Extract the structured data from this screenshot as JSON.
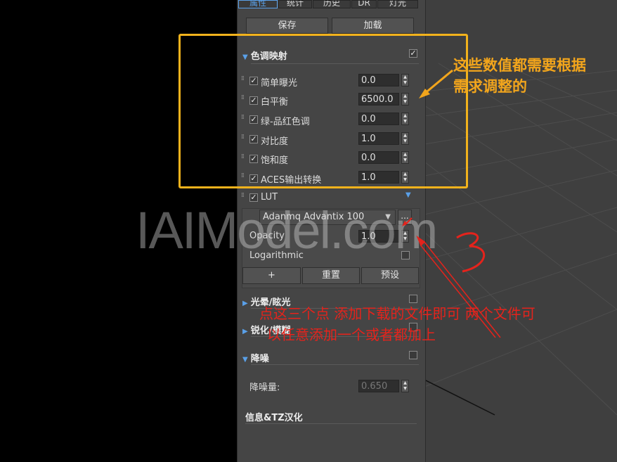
{
  "tabs": [
    {
      "label": "属性",
      "active": true
    },
    {
      "label": "统计",
      "active": false
    },
    {
      "label": "历史",
      "active": false
    },
    {
      "label": "DR",
      "active": false
    },
    {
      "label": "灯光",
      "active": false
    }
  ],
  "buttons": {
    "save": "保存",
    "load": "加载"
  },
  "tone_mapping": {
    "title": "色调映射",
    "enabled": true,
    "rows": [
      {
        "label": "简单曝光",
        "value": "0.0"
      },
      {
        "label": "白平衡",
        "value": "6500.0"
      },
      {
        "label": "绿-品红色调",
        "value": "0.0"
      },
      {
        "label": "对比度",
        "value": "1.0"
      },
      {
        "label": "饱和度",
        "value": "0.0"
      },
      {
        "label": "ACES输出转换",
        "value": "1.0"
      }
    ]
  },
  "lut": {
    "label": "LUT",
    "file": "Adanmq Advantix 100",
    "browse": "...",
    "opacity_label": "Opacity",
    "opacity_value": "1.0",
    "logarithmic_label": "Logarithmic",
    "add": "+",
    "reset": "重置",
    "preset": "预设"
  },
  "sections": {
    "bloom": "光晕/眩光",
    "sharpen": "锐化/模糊",
    "denoise": "降噪",
    "denoise_amount_label": "降噪量:",
    "denoise_amount": "0.650",
    "info": "信息&TZ汉化"
  },
  "annotations": {
    "orange_line1": "这些数值都需要根据",
    "orange_line2": "需求调整的",
    "red_line1": "点这三个点  添加下载的文件即可 两个文件可",
    "red_line2": "以任意添加一个或者都加上"
  },
  "watermark": "IAIModel.com",
  "colors": {
    "accent": "#5aa0e8",
    "annotation_orange": "#f2b21c",
    "annotation_red": "#e5231c",
    "panel": "#454545"
  }
}
